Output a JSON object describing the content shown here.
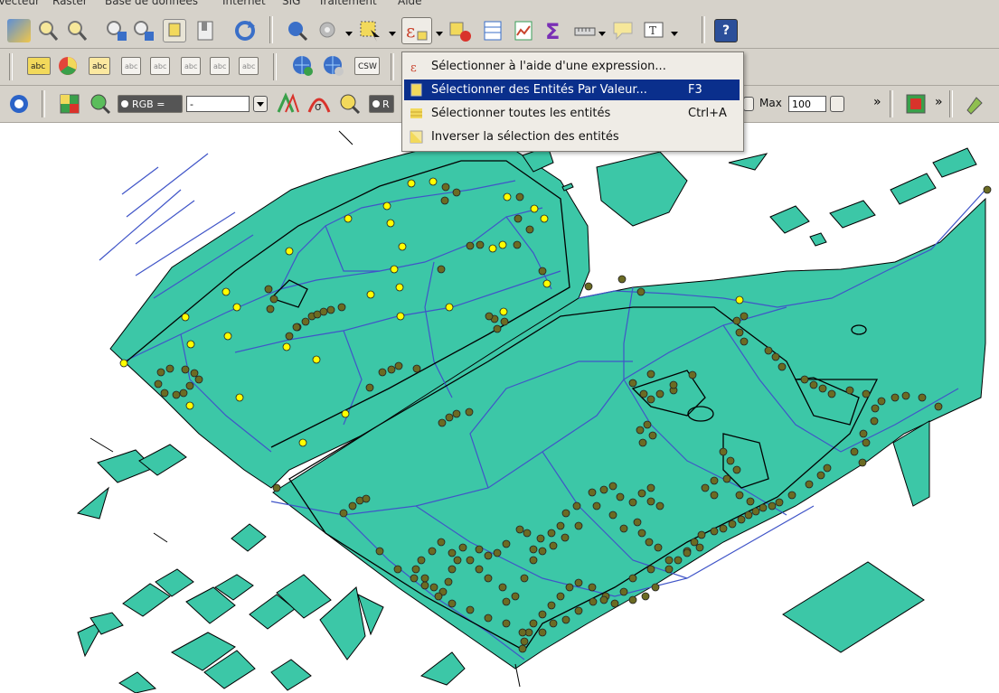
{
  "menubar": {
    "items": [
      "Vecteur",
      "Raster",
      "Base de données",
      "Internet",
      "SIG",
      "Traitement",
      "Aide"
    ]
  },
  "toolbar": {
    "label_chip": "abc",
    "csw_label": "CSW",
    "rgb_label": "RGB =",
    "rgb_value": "-",
    "rgb_label2": "R",
    "max_label": "Max",
    "max_value": "100",
    "overflow": "»",
    "help_label": "?"
  },
  "dropdown": {
    "items": [
      {
        "label": "Sélectionner à l'aide d'une expression...",
        "shortcut": "",
        "icon": "expression-icon"
      },
      {
        "label": "Sélectionner des Entités Par Valeur...",
        "shortcut": "F3",
        "icon": "form-select-icon"
      },
      {
        "label": "Sélectionner toutes les entités",
        "shortcut": "Ctrl+A",
        "icon": "select-all-icon"
      },
      {
        "label": "Inverser la sélection des entités",
        "shortcut": "",
        "icon": "invert-selection-icon"
      }
    ]
  },
  "colors": {
    "toolbar_bg": "#d6d2ca",
    "polygon_fill": "#3cc7a7",
    "line_blue": "#4055c8",
    "point_selected": "#ffff00",
    "point_default": "#6b6b23",
    "menu_highlight": "#0a2f8c"
  }
}
